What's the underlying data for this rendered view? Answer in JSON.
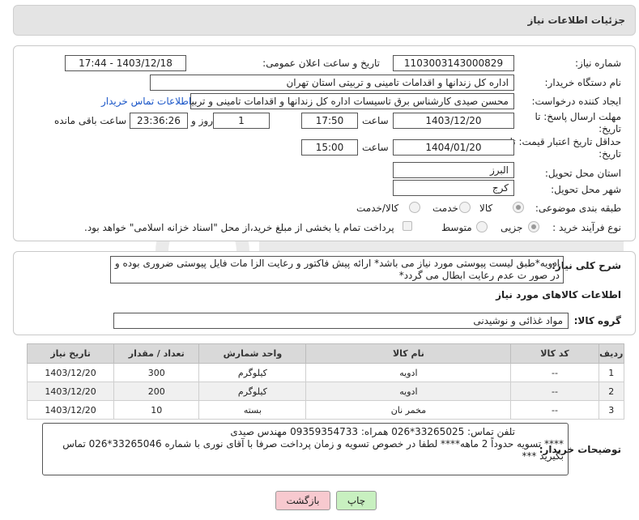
{
  "header": {
    "title": "جزئیات اطلاعات نیاز"
  },
  "form": {
    "need_number_label": "شماره نیاز:",
    "need_number": "1103003143000829",
    "announce_label": "تاریخ و ساعت اعلان عمومی:",
    "announce_value": "1403/12/18 - 17:44",
    "buyer_org_label": "نام دستگاه خریدار:",
    "buyer_org": "اداره کل زندانها و اقدامات تامینی و تربیتی استان تهران",
    "creator_label": "ایجاد کننده درخواست:",
    "creator": "محسن صیدی کارشناس برق تاسیسات  اداره کل زندانها و اقدامات تامینی و تربیتی",
    "contact_link": "اطلاعات تماس خریدار",
    "deadline_label": "مهلت ارسال پاسخ: تا تاریخ:",
    "deadline_date": "1403/12/20",
    "time_label": "ساعت",
    "deadline_time": "17:50",
    "days_value": "1",
    "days_label": "روز و",
    "remaining_time": "23:36:26",
    "remaining_label": "ساعت باقی مانده",
    "validity_label": "حداقل تاریخ اعتبار قیمت: تا تاریخ:",
    "validity_date": "1404/01/20",
    "validity_time": "15:00",
    "province_label": "استان محل تحویل:",
    "province": "البرز",
    "city_label": "شهر محل تحویل:",
    "city": "کرج",
    "category_label": "طبقه بندی موضوعی:",
    "category_options": [
      "کالا",
      "خدمت",
      "کالا/خدمت"
    ],
    "process_label": "نوع فرآیند خرید :",
    "process_options": [
      "جزیی",
      "متوسط"
    ],
    "payment_note": "پرداخت تمام یا بخشی از مبلغ خرید،از محل \"اسناد خزانه اسلامی\" خواهد بود."
  },
  "description": {
    "label": "شرح کلی نیاز:",
    "text": "ادویه*طبق لیست پیوستی مورد نیاز می باشد* ارائه پیش فاکتور و رعایت الزا مات فایل پیوستی ضروری بوده و در صور ت عدم رعایت ابطال می گردد*"
  },
  "goods_section": {
    "title": "اطلاعات کالاهای مورد نیاز",
    "group_label": "گروه کالا:",
    "group_value": "مواد غذائی و نوشیدنی"
  },
  "table": {
    "headers": [
      "ردیف",
      "کد کالا",
      "نام کالا",
      "واحد شمارش",
      "تعداد / مقدار",
      "تاریخ نیاز"
    ],
    "rows": [
      [
        "1",
        "--",
        "ادویه",
        "کیلوگرم",
        "300",
        "1403/12/20"
      ],
      [
        "2",
        "--",
        "ادویه",
        "کیلوگرم",
        "200",
        "1403/12/20"
      ],
      [
        "3",
        "--",
        "مخمر نان",
        "بسته",
        "10",
        "1403/12/20"
      ]
    ]
  },
  "buyer_notes": {
    "label": "توضیحات خریدار:",
    "line1": "تلفن تماس: 33265025*026      همراه: 09359354733     مهندس صیدی",
    "line2": "**** تسویه حدوداً 2 ماهه**** لطفا در خصوص تسویه و زمان پرداخت صرفا با آقای نوری با شماره 33265046*026 تماس بگیرید ***"
  },
  "buttons": {
    "print": "چاپ",
    "back": "بازگشت"
  },
  "colors": {
    "print_bg": "#c8f0c0",
    "back_bg": "#f7c9cf",
    "link": "#1a56c8"
  }
}
